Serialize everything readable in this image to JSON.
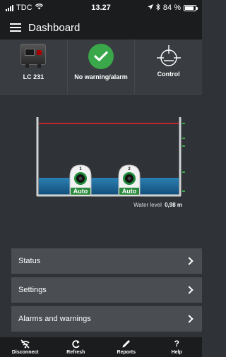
{
  "status_bar": {
    "carrier": "TDC",
    "time": "13.27",
    "battery": "84 %",
    "battery_level": 0.84
  },
  "header": {
    "title": "Dashboard"
  },
  "tiles": [
    {
      "label": "LC 231"
    },
    {
      "label": "No warning/alarm"
    },
    {
      "label": "Control"
    }
  ],
  "pumps": [
    {
      "number": "1",
      "mode": "Auto"
    },
    {
      "number": "2",
      "mode": "Auto"
    }
  ],
  "water": {
    "label": "Water level",
    "value": "0,98 m"
  },
  "menu": [
    {
      "label": "Status"
    },
    {
      "label": "Settings"
    },
    {
      "label": "Alarms and warnings"
    }
  ],
  "tabs": [
    {
      "label": "Disconnect",
      "icon": "disconnect-icon"
    },
    {
      "label": "Refresh",
      "icon": "refresh-icon"
    },
    {
      "label": "Reports",
      "icon": "reports-icon"
    },
    {
      "label": "Help",
      "icon": "help-icon"
    }
  ],
  "colors": {
    "ok_green": "#3aa84a",
    "alarm_line": "#c0262d",
    "water": "#1f6ea0",
    "sensor_green": "#3aa84a"
  }
}
